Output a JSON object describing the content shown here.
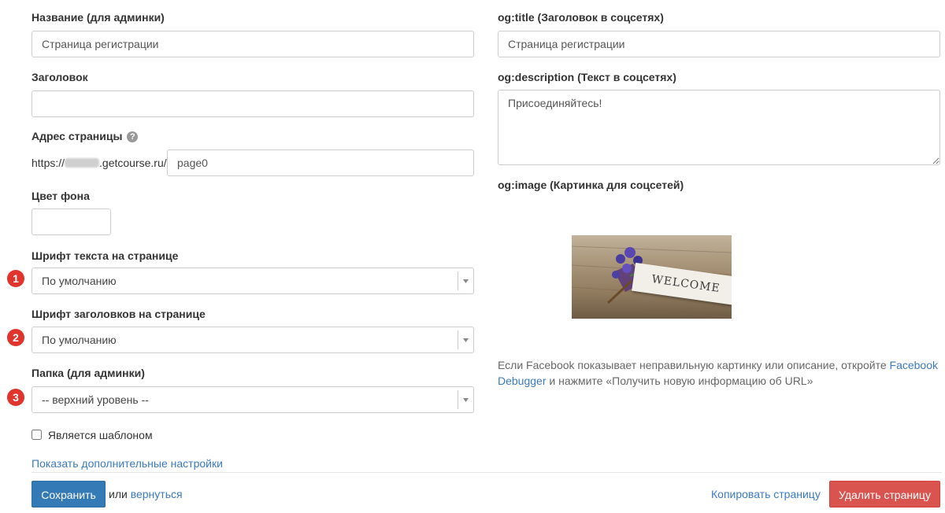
{
  "left": {
    "name_label": "Название (для админки)",
    "name_value": "Страница регистрации",
    "heading_label": "Заголовок",
    "heading_value": "",
    "address_label": "Адрес страницы",
    "address_prefix_start": "https://",
    "address_prefix_end": ".getcourse.ru/",
    "address_value": "page0",
    "bg_label": "Цвет фона",
    "font_text_label": "Шрифт текста на странице",
    "font_text_value": "По умолчанию",
    "font_head_label": "Шрифт заголовков на странице",
    "font_head_value": "По умолчанию",
    "folder_label": "Папка (для админки)",
    "folder_value": "-- верхний уровень --",
    "template_label": "Является шаблоном",
    "template_checked": false,
    "more_settings": "Показать дополнительные настройки"
  },
  "badges": [
    "1",
    "2",
    "3"
  ],
  "right": {
    "og_title_label": "og:title (Заголовок в соцсетях)",
    "og_title_value": "Страница регистрации",
    "og_desc_label": "og:description (Текст в соцсетях)",
    "og_desc_value": "Присоединяйтесь!",
    "og_image_label": "og:image (Картинка для соцсетей)",
    "image_sign_text": "WELCOME",
    "help_text_1": "Если Facebook показывает неправильную картинку или описание, откройте",
    "help_link": "Facebook Debugger",
    "help_text_2": "и нажмите «Получить новую информацию об URL»"
  },
  "footer": {
    "save": "Сохранить",
    "or": "или",
    "back": "вернуться",
    "copy": "Копировать страницу",
    "delete": "Удалить страницу"
  },
  "colors": {
    "primary": "#337ab7",
    "danger": "#d9534f",
    "link": "#3a7ac2",
    "badge": "#e0342c"
  }
}
